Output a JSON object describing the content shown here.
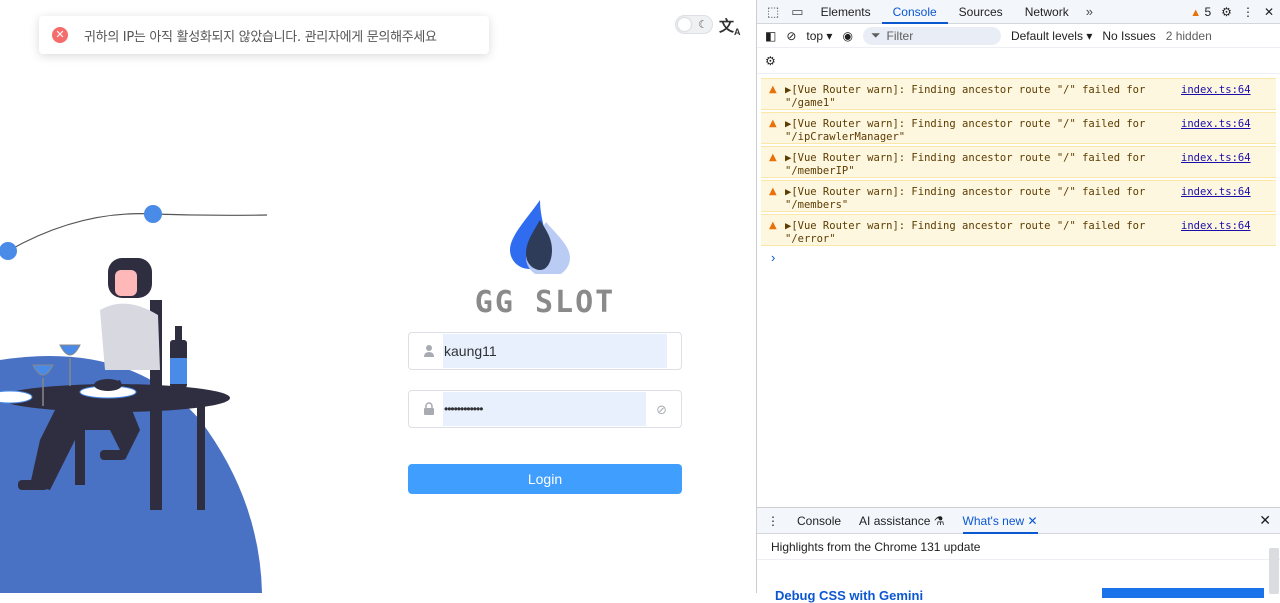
{
  "toast": {
    "icon": "close-circle-icon",
    "message": "귀하의 IP는 아직 활성화되지 않았습니다. 관리자에게 문의해주세요"
  },
  "controls": {
    "theme_toggle": "moon-icon",
    "language_icon": "translate-icon"
  },
  "login": {
    "brand": "GG SLOT",
    "username_value": "kaung11",
    "password_value": "••••••••••••",
    "login_label": "Login"
  },
  "devtools": {
    "tabs": [
      "Elements",
      "Console",
      "Sources",
      "Network"
    ],
    "active_tab": "Console",
    "more_tabs": "»",
    "warning_count": "5",
    "toolbar": {
      "context": "top",
      "filter_placeholder": "Filter",
      "levels": "Default levels",
      "issues": "No Issues",
      "hidden": "2 hidden"
    },
    "messages": [
      {
        "line1": "▶[Vue Router warn]: Finding ancestor route \"/\" failed for",
        "line2": "\"/game1\"",
        "source": "index.ts:64"
      },
      {
        "line1": "▶[Vue Router warn]: Finding ancestor route \"/\" failed for",
        "line2": "\"/ipCrawlerManager\"",
        "source": "index.ts:64"
      },
      {
        "line1": "▶[Vue Router warn]: Finding ancestor route \"/\" failed for",
        "line2": "\"/memberIP\"",
        "source": "index.ts:64"
      },
      {
        "line1": "▶[Vue Router warn]: Finding ancestor route \"/\" failed for",
        "line2": "\"/members\"",
        "source": "index.ts:64"
      },
      {
        "line1": "▶[Vue Router warn]: Finding ancestor route \"/\" failed for",
        "line2": "\"/error\"",
        "source": "index.ts:64"
      }
    ],
    "prompt": "›",
    "drawer": {
      "tabs": [
        "Console",
        "AI assistance",
        "What's new"
      ],
      "highlights": "Highlights from the Chrome 131 update",
      "headline": "Debug CSS with Gemini"
    }
  }
}
